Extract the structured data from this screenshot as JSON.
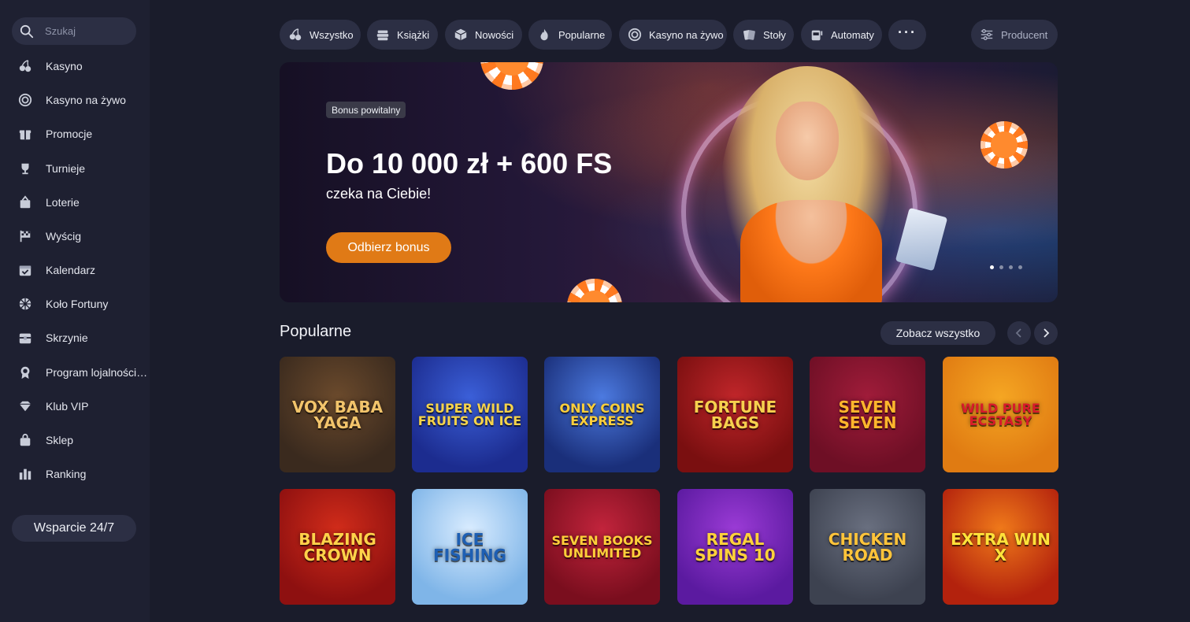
{
  "search": {
    "placeholder": "Szukaj"
  },
  "sidebar": {
    "items": [
      {
        "label": "Kasyno",
        "icon": "cherries-icon"
      },
      {
        "label": "Kasyno na żywo",
        "icon": "live-chip-icon"
      },
      {
        "label": "Promocje",
        "icon": "gift-icon"
      },
      {
        "label": "Turnieje",
        "icon": "trophy-icon"
      },
      {
        "label": "Loterie",
        "icon": "lottery-icon"
      },
      {
        "label": "Wyścig",
        "icon": "race-flag-icon"
      },
      {
        "label": "Kalendarz",
        "icon": "calendar-icon"
      },
      {
        "label": "Koło Fortuny",
        "icon": "wheel-icon"
      },
      {
        "label": "Skrzynie",
        "icon": "chest-icon"
      },
      {
        "label": "Program lojalnościo...",
        "icon": "loyalty-icon"
      },
      {
        "label": "Klub VIP",
        "icon": "diamond-icon"
      },
      {
        "label": "Sklep",
        "icon": "shop-bag-icon"
      },
      {
        "label": "Ranking",
        "icon": "ranking-icon"
      }
    ],
    "support_label": "Wsparcie 24/7"
  },
  "categories": [
    {
      "label": "Wszystko",
      "icon": "cherries-icon"
    },
    {
      "label": "Książki",
      "icon": "books-icon"
    },
    {
      "label": "Nowości",
      "icon": "cube-icon"
    },
    {
      "label": "Popularne",
      "icon": "flame-icon"
    },
    {
      "label": "Kasyno na żywo",
      "icon": "live-chip-icon"
    },
    {
      "label": "Stoły",
      "icon": "cards-icon"
    },
    {
      "label": "Automaty",
      "icon": "slot-machine-icon"
    }
  ],
  "more_label": "···",
  "producer_label": "Producent",
  "banner": {
    "badge": "Bonus powitalny",
    "headline": "Do 10 000 zł + 600 FS",
    "subline": "czeka na Ciebie!",
    "cta": "Odbierz bonus",
    "slides_total": 4,
    "active_slide": 1
  },
  "popular": {
    "title": "Popularne",
    "see_all": "Zobacz wszystko",
    "games": [
      {
        "title": "Vox Baba Yaga",
        "bg": [
          "#3a2a1e",
          "#6b4a2c"
        ],
        "color": "#f2c46b"
      },
      {
        "title": "Super Wild Fruits On Ice",
        "bg": [
          "#1c2c8f",
          "#3b5fd8"
        ],
        "color": "#f6d34a"
      },
      {
        "title": "Only Coins Express",
        "bg": [
          "#1a2f7a",
          "#4c7ae0"
        ],
        "color": "#ffcf3a"
      },
      {
        "title": "Fortune Bags",
        "bg": [
          "#7a0f10",
          "#c0262a"
        ],
        "color": "#f7d04e"
      },
      {
        "title": "Seven Seven",
        "bg": [
          "#6e0f25",
          "#a01c3a"
        ],
        "color": "#ffb62c"
      },
      {
        "title": "Wild Pure Ecstasy",
        "bg": [
          "#e07b12",
          "#f5a623"
        ],
        "color": "#d81b2c"
      },
      {
        "title": "Blazing Crown",
        "bg": [
          "#8e1010",
          "#d12c1a"
        ],
        "color": "#ffd24a"
      },
      {
        "title": "Ice Fishing",
        "bg": [
          "#7fb5e8",
          "#d9ecff"
        ],
        "color": "#1e5fb3"
      },
      {
        "title": "Seven Books Unlimited",
        "bg": [
          "#7a0e1e",
          "#c2243c"
        ],
        "color": "#ffcf3a"
      },
      {
        "title": "Regal Spins 10",
        "bg": [
          "#5b1aa0",
          "#9b3bd6"
        ],
        "color": "#ffd23a"
      },
      {
        "title": "Chicken Road",
        "bg": [
          "#3d4250",
          "#6a7080"
        ],
        "color": "#ffc43a"
      },
      {
        "title": "Extra Win X",
        "bg": [
          "#b3220d",
          "#f07a1a"
        ],
        "color": "#ffe23a"
      }
    ]
  },
  "colors": {
    "accent": "#e07a16",
    "panel": "#2c2f44",
    "background": "#1a1c2b"
  }
}
